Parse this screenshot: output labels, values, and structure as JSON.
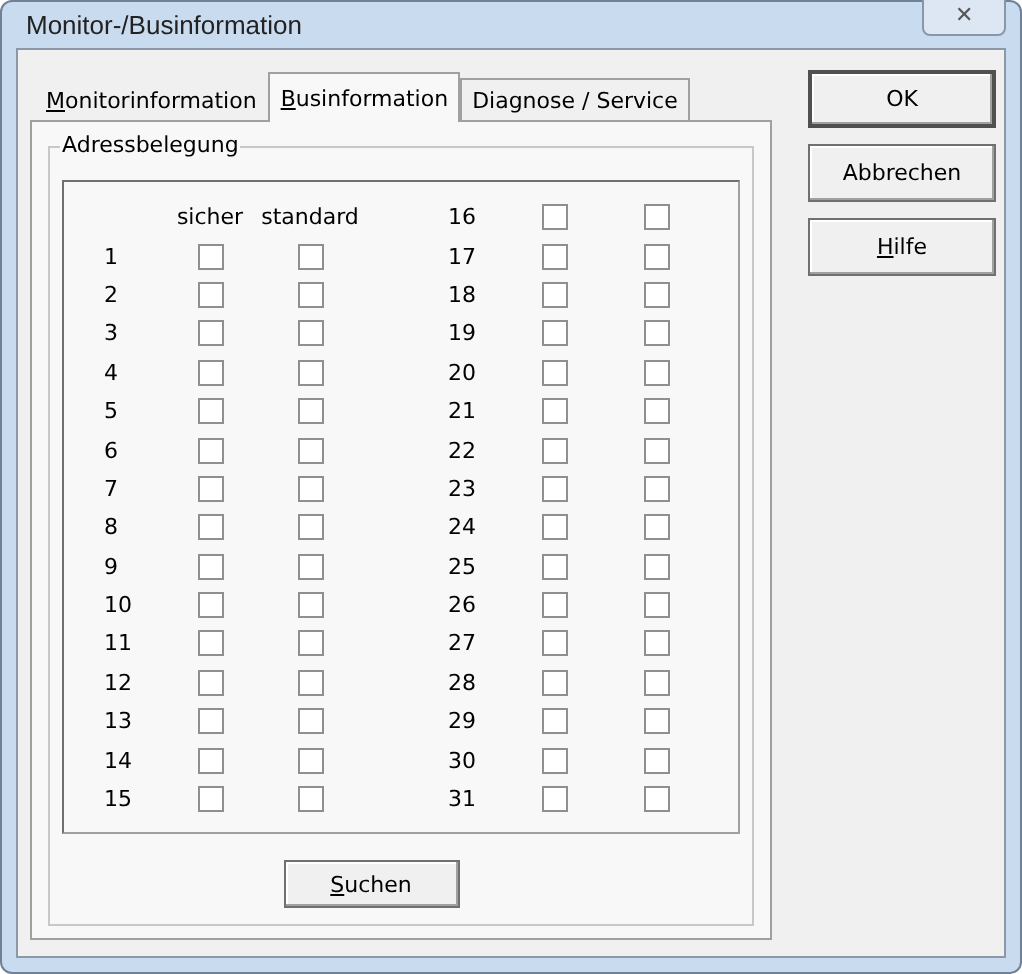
{
  "window": {
    "title": "Monitor-/Businformation",
    "close": "✕"
  },
  "tabs": [
    {
      "label": "Monitorinformation",
      "selected": false,
      "mnemonic": true
    },
    {
      "label": "Businformation",
      "selected": true,
      "mnemonic": true
    },
    {
      "label": "Diagnose / Service",
      "selected": false,
      "mnemonic": false
    }
  ],
  "group": {
    "title": "Adressbelegung",
    "headers": [
      "sicher",
      "standard"
    ],
    "left_rows": [
      {
        "number": "1",
        "checks": [
          false,
          false
        ]
      },
      {
        "number": "2",
        "checks": [
          false,
          false
        ]
      },
      {
        "number": "3",
        "checks": [
          false,
          false
        ]
      },
      {
        "number": "4",
        "checks": [
          false,
          false
        ]
      },
      {
        "number": "5",
        "checks": [
          false,
          false
        ]
      },
      {
        "number": "6",
        "checks": [
          false,
          false
        ]
      },
      {
        "number": "7",
        "checks": [
          false,
          false
        ]
      },
      {
        "number": "8",
        "checks": [
          false,
          false
        ]
      },
      {
        "number": "9",
        "checks": [
          false,
          false
        ]
      },
      {
        "number": "10",
        "checks": [
          false,
          false
        ]
      },
      {
        "number": "11",
        "checks": [
          false,
          false
        ]
      },
      {
        "number": "12",
        "checks": [
          false,
          false
        ]
      },
      {
        "number": "13",
        "checks": [
          false,
          false
        ]
      },
      {
        "number": "14",
        "checks": [
          false,
          false
        ]
      },
      {
        "number": "15",
        "checks": [
          false,
          false
        ]
      }
    ],
    "right_rows": [
      {
        "number": "16",
        "checks": [
          false,
          false
        ]
      },
      {
        "number": "17",
        "checks": [
          false,
          false
        ]
      },
      {
        "number": "18",
        "checks": [
          false,
          false
        ]
      },
      {
        "number": "19",
        "checks": [
          false,
          false
        ]
      },
      {
        "number": "20",
        "checks": [
          false,
          false
        ]
      },
      {
        "number": "21",
        "checks": [
          false,
          false
        ]
      },
      {
        "number": "22",
        "checks": [
          false,
          false
        ]
      },
      {
        "number": "23",
        "checks": [
          false,
          false
        ]
      },
      {
        "number": "24",
        "checks": [
          false,
          false
        ]
      },
      {
        "number": "25",
        "checks": [
          false,
          false
        ]
      },
      {
        "number": "26",
        "checks": [
          false,
          false
        ]
      },
      {
        "number": "27",
        "checks": [
          false,
          false
        ]
      },
      {
        "number": "28",
        "checks": [
          false,
          false
        ]
      },
      {
        "number": "29",
        "checks": [
          false,
          false
        ]
      },
      {
        "number": "30",
        "checks": [
          false,
          false
        ]
      },
      {
        "number": "31",
        "checks": [
          false,
          false
        ]
      }
    ]
  },
  "search_button": {
    "label": "Suchen",
    "mnemonic": true
  },
  "buttons": [
    {
      "label": "OK",
      "mnemonic": false,
      "default": true
    },
    {
      "label": "Abbrechen",
      "mnemonic": false,
      "default": false
    },
    {
      "label": "Hilfe",
      "mnemonic": true,
      "default": false
    }
  ]
}
